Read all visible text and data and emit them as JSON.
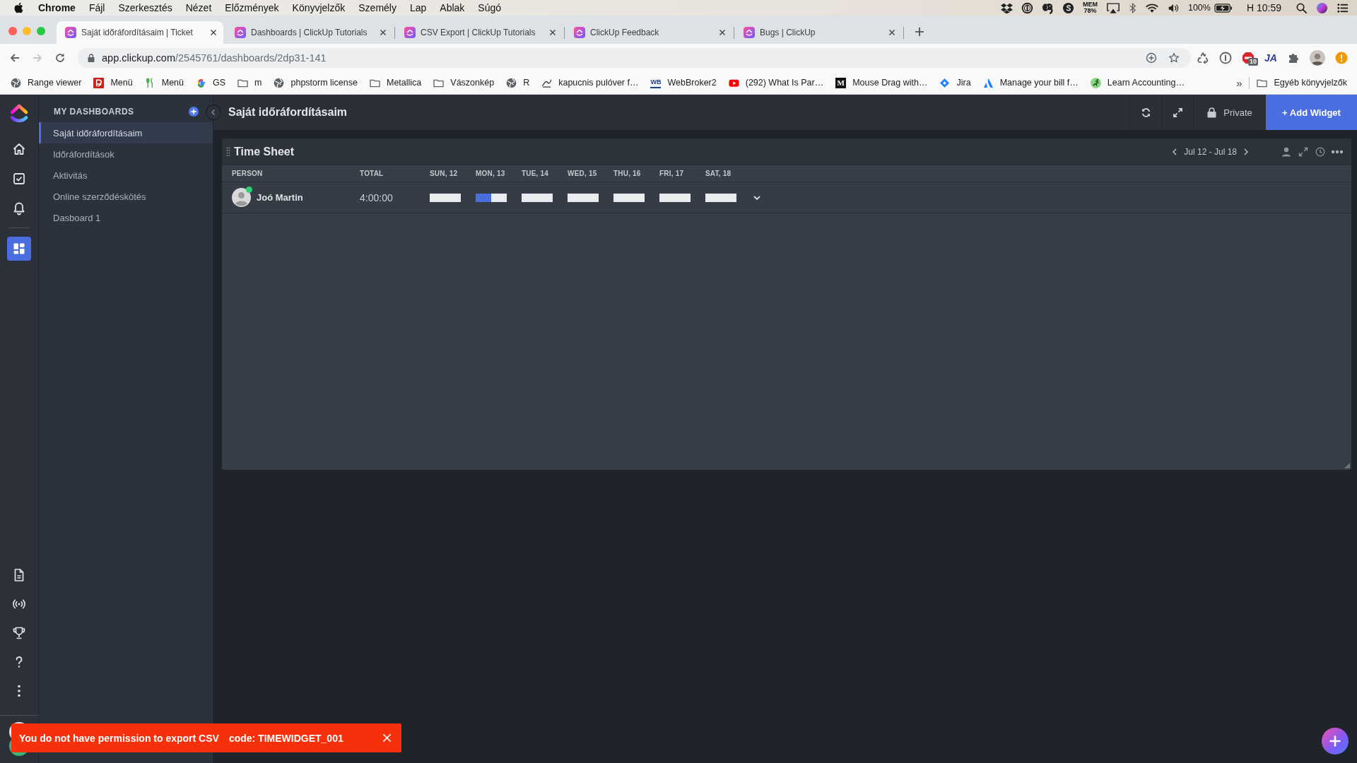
{
  "menu_bar": {
    "app_name": "Chrome",
    "menus": [
      "Fájl",
      "Szerkesztés",
      "Nézet",
      "Előzmények",
      "Könyvjelzők",
      "Személy",
      "Lap",
      "Ablak",
      "Súgó"
    ],
    "memory_label": "MEM",
    "memory_value": "78%",
    "battery": "100%",
    "clock": "H 10:59"
  },
  "browser": {
    "tabs": [
      {
        "title": "Saját időráfordításaim | Ticket",
        "selected": true
      },
      {
        "title": "Dashboards | ClickUp Tutorials",
        "selected": false
      },
      {
        "title": "CSV Export | ClickUp Tutorials",
        "selected": false
      },
      {
        "title": "ClickUp Feedback",
        "selected": false
      },
      {
        "title": "Bugs | ClickUp",
        "selected": false
      }
    ],
    "can_go_forward": false,
    "url": {
      "host": "app.clickup.com",
      "path": "/2545761/dashboards/2dp31-141"
    },
    "extensions": {
      "blocked_count": "10",
      "letters": "JA"
    },
    "bookmarks": [
      {
        "label": "Range viewer",
        "kind": "globe"
      },
      {
        "label": "Menü",
        "kind": "tile"
      },
      {
        "label": "Menü",
        "kind": "fork"
      },
      {
        "label": "GS",
        "kind": "google"
      },
      {
        "label": "m",
        "kind": "folder"
      },
      {
        "label": "phpstorm license",
        "kind": "globe"
      },
      {
        "label": "Metallica",
        "kind": "folder"
      },
      {
        "label": "Vászonkép",
        "kind": "folder"
      },
      {
        "label": "R",
        "kind": "globe"
      },
      {
        "label": "kapucnis pulóver f…",
        "kind": "scribble"
      },
      {
        "label": "WebBroker2",
        "kind": "letter_light",
        "logo_text": "WB"
      },
      {
        "label": "(292) What Is Par…",
        "kind": "video"
      },
      {
        "label": "Mouse Drag with…",
        "kind": "letter_dark",
        "logo_text": "M"
      },
      {
        "label": "Jira",
        "kind": "diamond"
      },
      {
        "label": "Manage your bill f…",
        "kind": "peak"
      },
      {
        "label": "Learn Accounting…",
        "kind": "runner"
      }
    ],
    "more": "»",
    "other_bookmarks": "Egyéb könyvjelzők"
  },
  "nav_rail": {
    "items": [
      {
        "kind": "home",
        "selected": false
      },
      {
        "kind": "tasks",
        "selected": false
      },
      {
        "kind": "notifications",
        "selected": false
      },
      {
        "kind": "dashboards",
        "selected": true
      }
    ]
  },
  "sidebar": {
    "title": "MY DASHBOARDS",
    "items": [
      {
        "label": "Saját időráfordításaim",
        "selected": true
      },
      {
        "label": "Időráfordítások",
        "selected": false
      },
      {
        "label": "Aktivitás",
        "selected": false
      },
      {
        "label": "Online szerződéskötés",
        "selected": false
      },
      {
        "label": "Dasboard 1",
        "selected": false
      }
    ]
  },
  "header": {
    "title": "Saját időráfordításaim",
    "privacy": "Private",
    "add_button": "+ Add Widget"
  },
  "widget": {
    "title": "Time Sheet",
    "date_range": "Jul 12 - Jul 18",
    "columns": [
      "PERSON",
      "TOTAL",
      "SUN, 12",
      "MON, 13",
      "TUE, 14",
      "WED, 15",
      "THU, 16",
      "FRI, 17",
      "SAT, 18"
    ],
    "rows": [
      {
        "person": "Joó Martin",
        "online": true,
        "total": "4:00:00",
        "days": [
          {
            "level": 0
          },
          {
            "level": 0.5
          },
          {
            "level": 0
          },
          {
            "level": 0
          },
          {
            "level": 0
          },
          {
            "level": 0
          },
          {
            "level": 0
          }
        ]
      }
    ]
  },
  "toast": {
    "message": "You do not have permission to export CSV",
    "code": "code: TIMEWIDGET_001"
  }
}
